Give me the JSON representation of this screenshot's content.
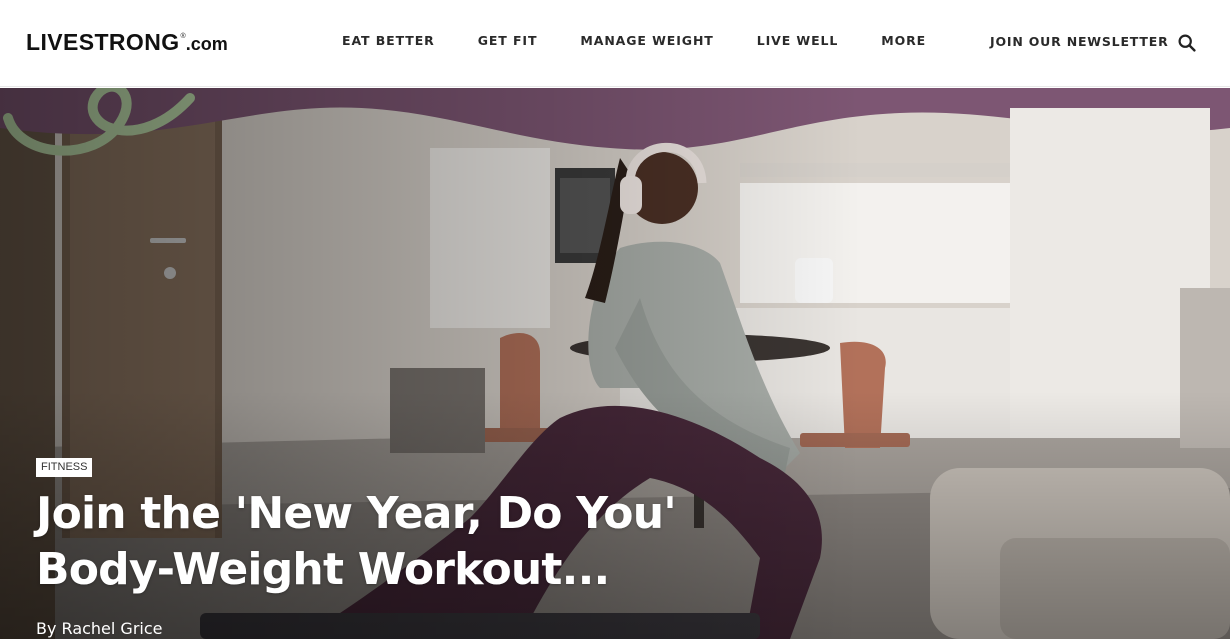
{
  "brand": {
    "logo_main": "LIVESTRONG",
    "logo_registered": "®",
    "logo_suffix": ".com"
  },
  "nav": {
    "items": [
      {
        "label": "EAT BETTER"
      },
      {
        "label": "GET FIT"
      },
      {
        "label": "MANAGE WEIGHT"
      },
      {
        "label": "LIVE WELL"
      },
      {
        "label": "MORE"
      }
    ],
    "newsletter_label": "JOIN OUR NEWSLETTER",
    "search_icon": "search-icon"
  },
  "hero": {
    "category": "FITNESS",
    "title": "Join the 'New Year, Do You' Body-Weight Workout...",
    "byline_prefix": "By",
    "author": "Rachel Grice"
  },
  "colors": {
    "header_bg": "#ffffff",
    "nav_text": "#2a2a2a",
    "hero_text": "#ffffff",
    "wave_purple": "#7d5673",
    "swirl_green": "#b9d6a7",
    "leggings_plum": "#4a2a3c"
  }
}
